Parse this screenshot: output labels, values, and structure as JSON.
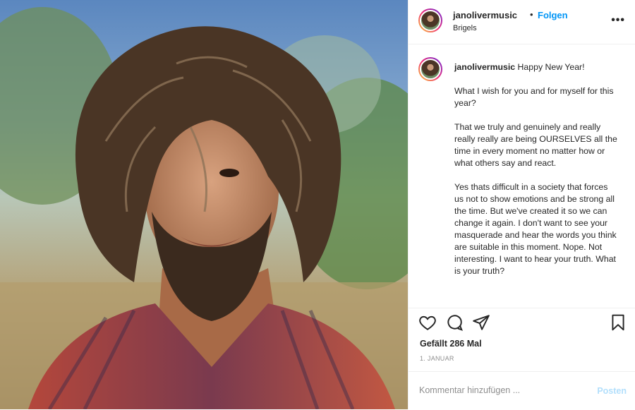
{
  "post": {
    "photo_subject": "portrait-photo"
  },
  "header": {
    "username": "janolivermusic",
    "dot": "•",
    "follow_label": "Folgen",
    "location": "Brigels",
    "more_label": "•••"
  },
  "caption": {
    "username": "janolivermusic",
    "opening": "Happy New Year!",
    "paragraphs": [
      "What I wish for you and for myself for this year?",
      "That we truly and genuinely and really really really are being OURSELVES all the time in every moment no matter how or what others say and react.",
      "Yes thats difficult in a society that forces us not to show emotions and be strong all the time. But we've created it so we can change it again. I don't want to see your masquerade and hear the words you think are suitable in this moment. Nope. Not interesting. I want to hear your truth. What is your truth?"
    ]
  },
  "actions": {
    "icons": [
      "heart-icon",
      "comment-icon",
      "share-icon",
      "bookmark-icon"
    ]
  },
  "likes_text": "Gefällt 286 Mal",
  "date_text": "1. JANUAR",
  "comment": {
    "placeholder": "Kommentar hinzufügen ...",
    "post_label": "Posten"
  },
  "colors": {
    "link_blue": "#0095f6",
    "post_disabled": "#b2dffc",
    "muted": "#8e8e8e",
    "text": "#262626"
  }
}
